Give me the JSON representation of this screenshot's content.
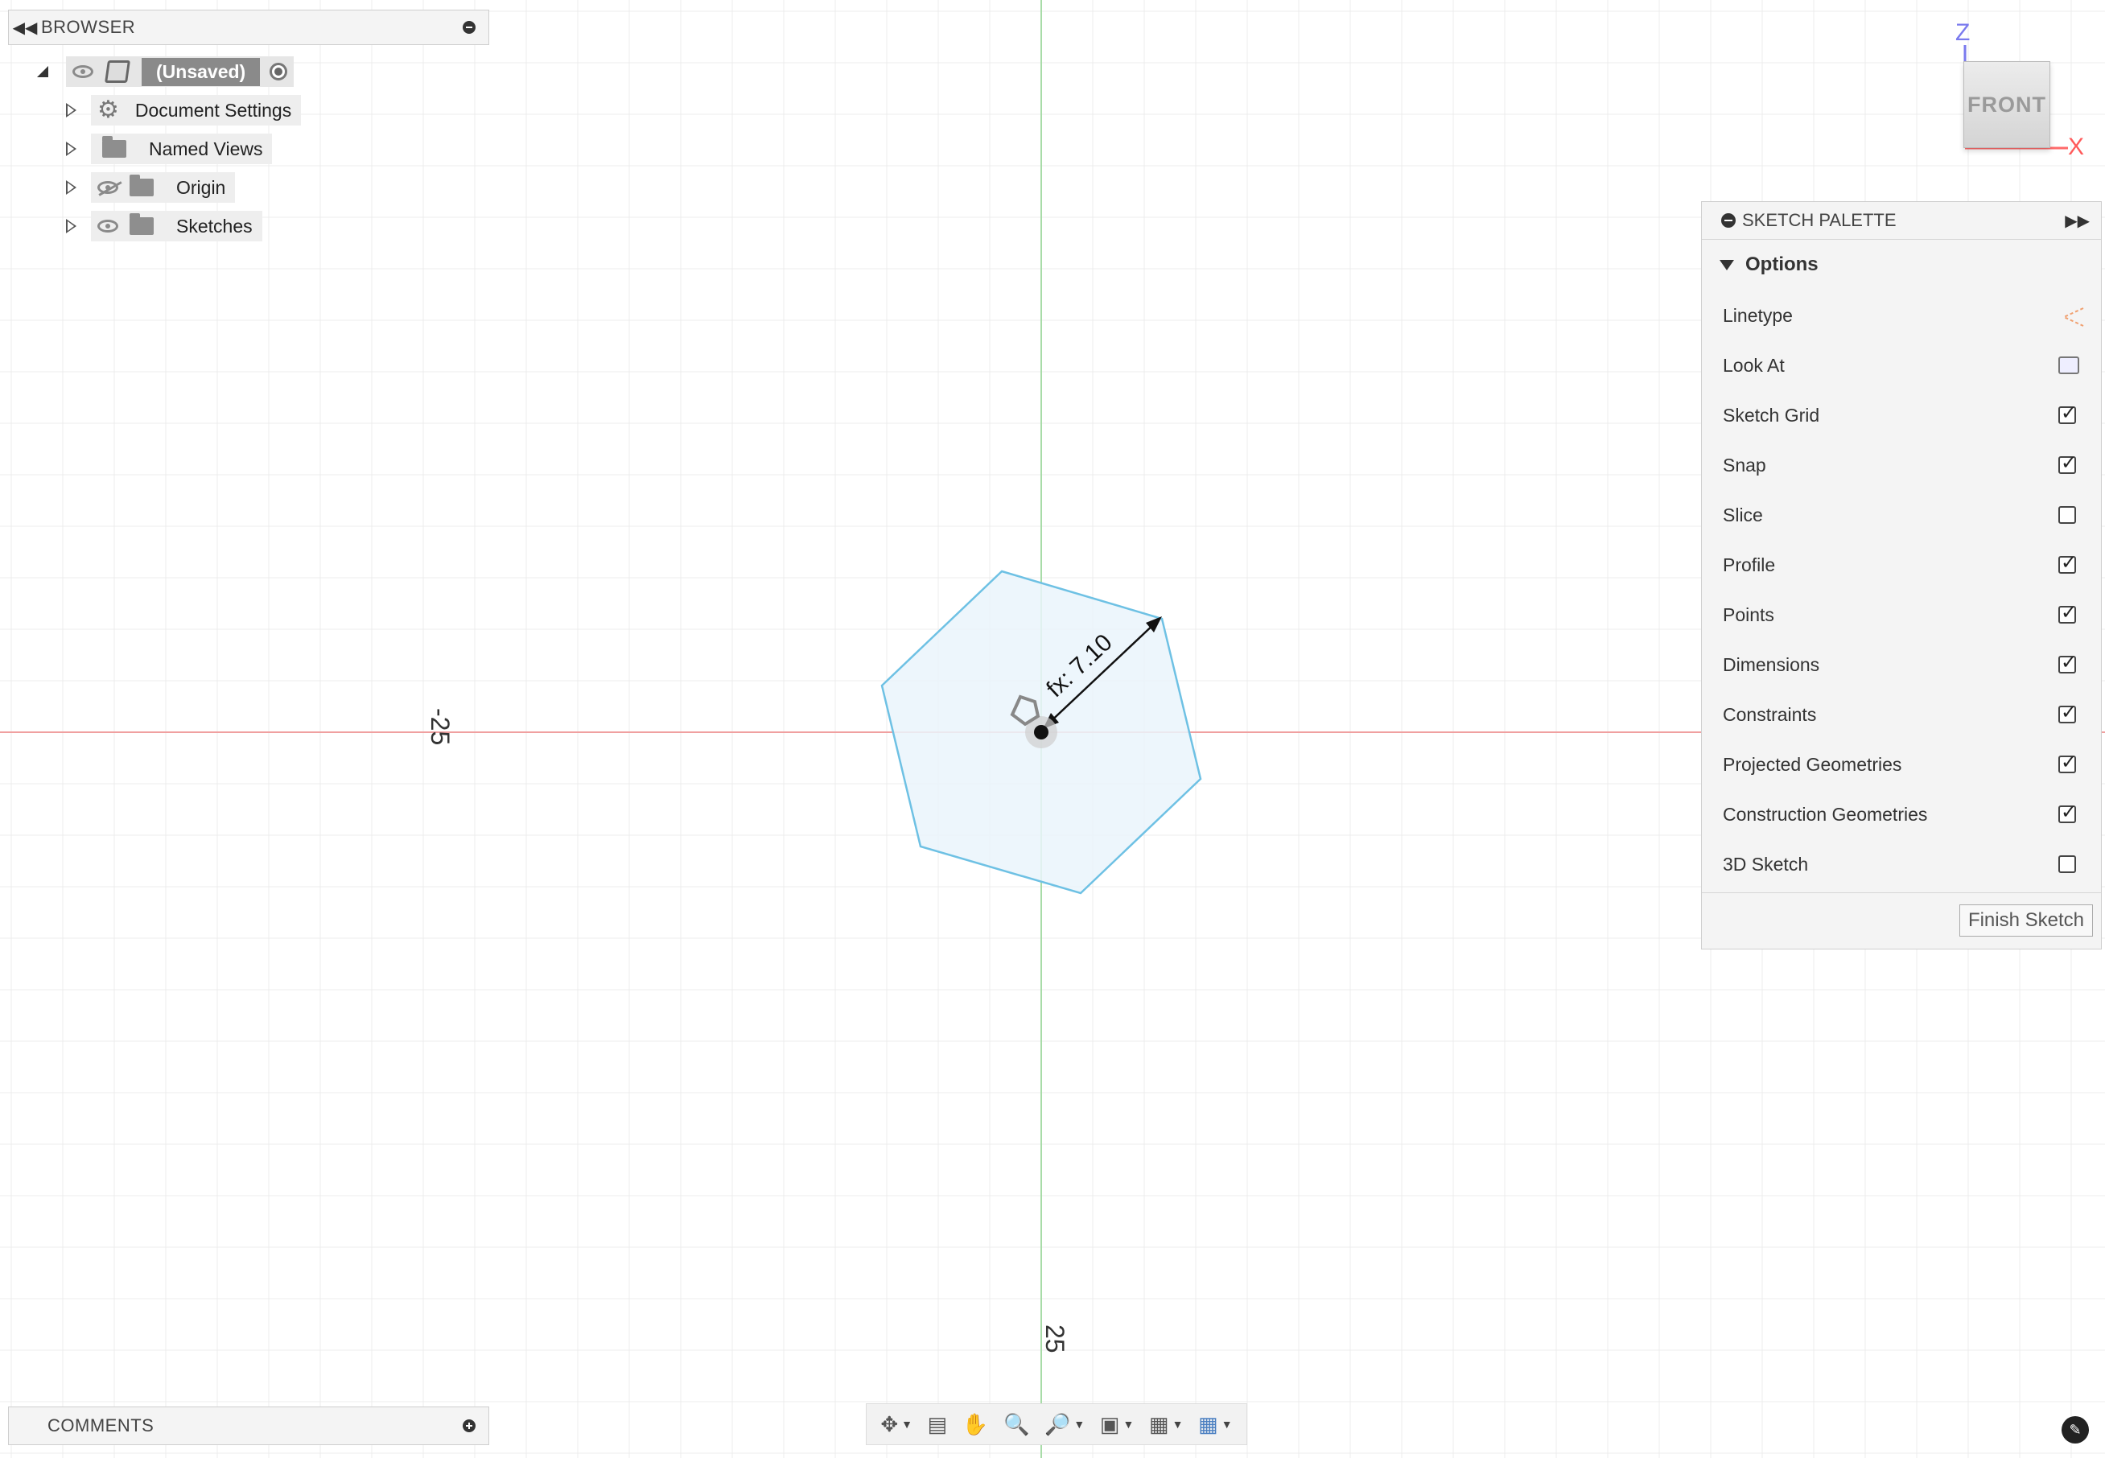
{
  "browser": {
    "title": "BROWSER",
    "root": {
      "label": "(Unsaved)"
    },
    "items": [
      {
        "label": "Document Settings",
        "icon": "gear-icon"
      },
      {
        "label": "Named Views",
        "icon": "folder-icon"
      },
      {
        "label": "Origin",
        "icon": "folder-icon",
        "visible": false
      },
      {
        "label": "Sketches",
        "icon": "folder-icon",
        "visible": true
      }
    ]
  },
  "viewcube": {
    "face": "FRONT",
    "axis_z": "Z",
    "axis_x": "X"
  },
  "canvas": {
    "dimension_label": "fx: 7.10",
    "ruler_left": "-25",
    "ruler_bottom": "25",
    "sketch_color": "#6ec1e4",
    "axis_red": "#f08080",
    "axis_green": "#90d890"
  },
  "sketch_palette": {
    "title": "SKETCH PALETTE",
    "section": "Options",
    "options": [
      {
        "label": "Linetype",
        "type": "icons"
      },
      {
        "label": "Look At",
        "type": "button"
      },
      {
        "label": "Sketch Grid",
        "checked": true
      },
      {
        "label": "Snap",
        "checked": true
      },
      {
        "label": "Slice",
        "checked": false
      },
      {
        "label": "Profile",
        "checked": true
      },
      {
        "label": "Points",
        "checked": true
      },
      {
        "label": "Dimensions",
        "checked": true
      },
      {
        "label": "Constraints",
        "checked": true
      },
      {
        "label": "Projected Geometries",
        "checked": true
      },
      {
        "label": "Construction Geometries",
        "checked": true
      },
      {
        "label": "3D Sketch",
        "checked": false
      }
    ],
    "finish_label": "Finish Sketch"
  },
  "comments": {
    "title": "COMMENTS"
  },
  "toolbar": {
    "items": [
      "orbit-icon",
      "look-at-icon",
      "pan-icon",
      "zoom-icon",
      "zoom-window-icon",
      "display-settings-icon",
      "grid-icon",
      "viewports-icon"
    ]
  }
}
